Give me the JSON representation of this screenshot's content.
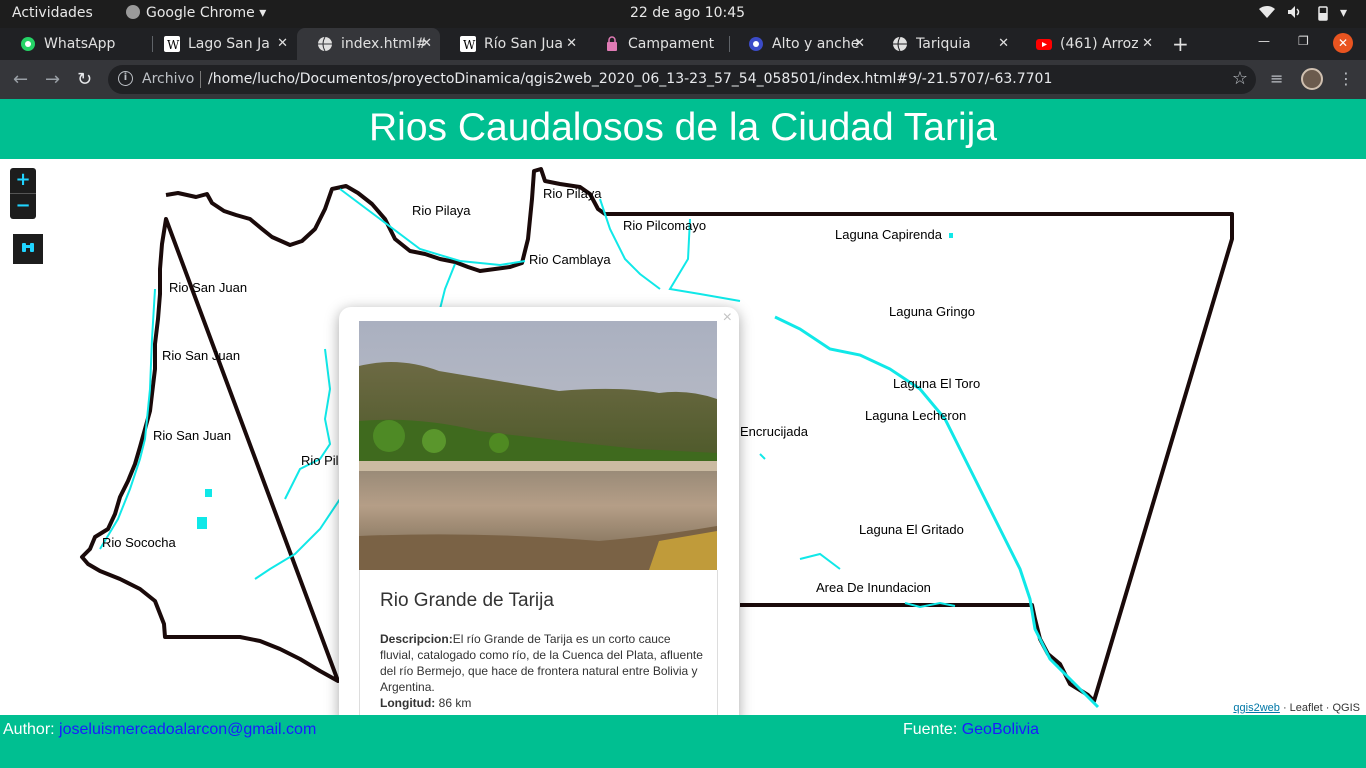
{
  "system_bar": {
    "activities": "Actividades",
    "app_name": "Google Chrome",
    "clock": "22 de ago  10:45"
  },
  "tabs": [
    {
      "title": "WhatsApp",
      "icon": "whatsapp-icon",
      "active": false
    },
    {
      "title": "Lago San Ja",
      "icon": "wikipedia-icon",
      "active": false
    },
    {
      "title": "index.html#",
      "icon": "globe-icon",
      "active": true
    },
    {
      "title": "Río San Jua",
      "icon": "wikipedia-icon",
      "active": false
    },
    {
      "title": "Campament",
      "icon": "lock-icon",
      "active": false
    },
    {
      "title": "Alto y anche",
      "icon": "circle-icon",
      "active": false
    },
    {
      "title": "Tariquia",
      "icon": "globe-icon",
      "active": false
    },
    {
      "title": "(461) Arroz",
      "icon": "youtube-icon",
      "active": false
    }
  ],
  "address_bar": {
    "scheme_label": "Archivo",
    "url": "/home/lucho/Documentos/proyectoDinamica/qgis2web_2020_06_13-23_57_54_058501/index.html#9/-21.5707/-63.7701"
  },
  "page": {
    "title": "Rios Caudalosos de la Ciudad Tarija"
  },
  "map": {
    "zoom_in": "+",
    "zoom_out": "−",
    "labels": [
      "Rio Pilaya",
      "Rio Pilaya",
      "Rio Pilcomayo",
      "Rio Camblaya",
      "Laguna Capirenda",
      "Rio San Juan",
      "Rio San Juan",
      "Rio San Juan",
      "Laguna Gringo",
      "Laguna El Toro",
      "Laguna Lecheron",
      "Encrucijada",
      "Rio Pil",
      "Rio Sococha",
      "Laguna El Gritado",
      "Area De Inundacion"
    ],
    "attribution": {
      "qgis2web": "qgis2web",
      "sep": " · ",
      "leaflet": "Leaflet",
      "qgis": "QGIS"
    },
    "colors": {
      "boundary": "#1a0a0a",
      "river": "#10e8e8",
      "accent": "#00bf91"
    }
  },
  "popup": {
    "close": "×",
    "title": "Rio Grande de Tarija",
    "desc_label": "Descripcion:",
    "desc_text": "El río Grande de Tarija es un corto cauce fluvial, catalogado como río, de la Cuenca del Plata, afluente del río Bermejo, que hace de frontera natural entre Bolivia y Argentina.",
    "length_label": "Longitud:",
    "length_value": " 86 km"
  },
  "footer": {
    "author_label": "Author: ",
    "author_email": "joseluismercadoalarcon@gmail.com",
    "source_label": "Fuente: ",
    "source_link": "GeoBolivia"
  }
}
